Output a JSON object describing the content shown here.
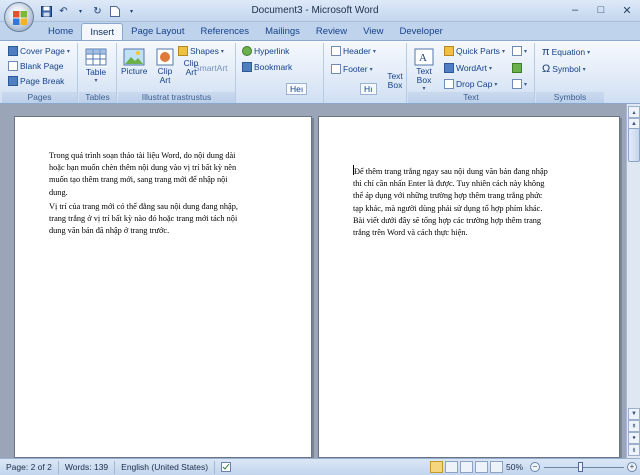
{
  "window": {
    "title": "Document3 - Microsoft Word",
    "controls": {
      "minimize": "–",
      "maximize": "□",
      "close": "✕"
    }
  },
  "qat": {
    "save_icon": "save-icon",
    "undo_icon": "undo-icon",
    "redo_icon": "redo-icon",
    "new_icon": "new-document-icon"
  },
  "tabs": [
    {
      "label": "Home",
      "active": false
    },
    {
      "label": "Insert",
      "active": true
    },
    {
      "label": "Page Layout",
      "active": false
    },
    {
      "label": "References",
      "active": false
    },
    {
      "label": "Mailings",
      "active": false
    },
    {
      "label": "Review",
      "active": false
    },
    {
      "label": "View",
      "active": false
    },
    {
      "label": "Developer",
      "active": false
    }
  ],
  "ribbon": {
    "pages": {
      "label": "Pages",
      "cover_page": "Cover Page",
      "blank_page": "Blank Page",
      "page_break": "Page Break"
    },
    "tables": {
      "label": "Tables",
      "table": "Table"
    },
    "illustrations": {
      "label": "Illustrat trastrustus",
      "picture": "Picture",
      "clip_art": "Clip Art",
      "clip_art2": "Clip Art",
      "shapes": "Shapes",
      "smartart": "SmartArt"
    },
    "links": {
      "hyperlink": "Hyperlink",
      "bookmark": "Bookmark"
    },
    "header_footer": {
      "header": "Header",
      "footer": "Footer",
      "header_frag": "Heı",
      "hr_frag": "Hı"
    },
    "text": {
      "label": "Text",
      "text_box": "Text Box",
      "text_box2": "Text Box",
      "quick_parts": "Quick Parts",
      "wordart": "WordArt",
      "drop_cap": "Drop Cap"
    },
    "symbols": {
      "label": "Symbols",
      "equation": "Equation",
      "symbol": "Symbol"
    }
  },
  "document": {
    "page1_paragraphs": [
      "Trong quá trình soạn thảo tài liệu Word, do nội dung dài\nhoặc bạn muốn chèn thêm nội dung vào vị trí bất kỳ nên\nmuốn tạo thêm trang mới, sang trang mới để nhập nội\ndung.",
      "Vị trí của trang mới có thể đằng sau nội dung đang nhập,\ntrang trắng ở vị trí bất kỳ nào đó hoặc trang mới tách nội\ndung văn bản đã nhập ở trang trước."
    ],
    "page2_paragraph": "Để thêm trang trắng ngay sau nội dung văn bản đang nhập\nthì chỉ cần nhấn Enter là được. Tuy nhiên cách này không\nthể áp dụng với những trường hợp thêm trang trắng phức\ntạp khác, mà người dùng phải sử dụng tổ hợp phím khác.\nBài viết dưới đây sẽ tổng hợp các trường hợp thêm trang\ntrắng trên Word và cách thực hiện."
  },
  "status": {
    "page": "Page: 2 of 2",
    "words": "Words: 139",
    "language": "English (United States)",
    "zoom": "50%",
    "zoom_level_percent": 50
  }
}
